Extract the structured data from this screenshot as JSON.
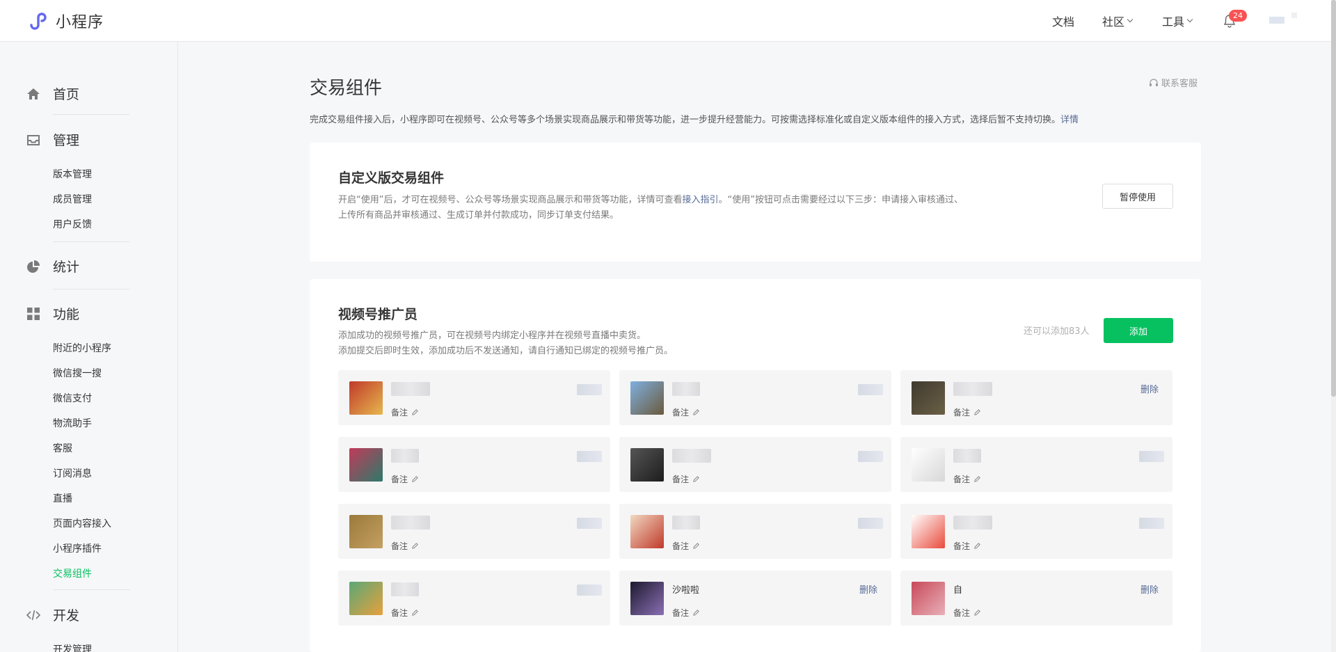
{
  "header": {
    "app_name": "小程序",
    "nav": [
      {
        "label": "文档",
        "dropdown": false
      },
      {
        "label": "社区",
        "dropdown": true
      },
      {
        "label": "工具",
        "dropdown": true
      }
    ],
    "notification_count": "24"
  },
  "sidebar": {
    "sections": [
      {
        "label": "首页",
        "icon": "home-icon"
      },
      {
        "label": "管理",
        "icon": "inbox-icon"
      },
      {
        "label": "统计",
        "icon": "pie-chart-icon"
      },
      {
        "label": "功能",
        "icon": "grid-icon"
      },
      {
        "label": "开发",
        "icon": "code-icon"
      }
    ],
    "manage_items": [
      "版本管理",
      "成员管理",
      "用户反馈"
    ],
    "feature_items": [
      "附近的小程序",
      "微信搜一搜",
      "微信支付",
      "物流助手",
      "客服",
      "订阅消息",
      "直播",
      "页面内容接入",
      "小程序插件",
      "交易组件"
    ],
    "dev_items": [
      "开发管理"
    ],
    "active_item": "交易组件"
  },
  "main": {
    "title": "交易组件",
    "service_link": "联系客服",
    "intro": "完成交易组件接入后，小程序即可在视频号、公众号等多个场景实现商品展示和带货等功能，进一步提升经营能力。可按需选择标准化或自定义版本组件的接入方式，选择后暂不支持切换。",
    "intro_link": "详情",
    "custom_card": {
      "title": "自定义版交易组件",
      "desc_prefix": "开启“使用”后，才可在视频号、公众号等场景实现商品展示和带货等功能，详情可查看",
      "desc_link": "接入指引",
      "desc_suffix": "。“使用”按钮可点击需要经过以下三步：申请接入审核通过、",
      "desc_line2": "上传所有商品并审核通过、生成订单并付款成功，同步订单支付结果。",
      "button": "暂停使用"
    },
    "promoter_card": {
      "title": "视频号推广员",
      "desc_line1": "添加成功的视频号推广员，可在视频号内绑定小程序并在视频号直播中卖货。",
      "desc_line2": "添加提交后即时生效，添加成功后不发送通知，请自行通知已绑定的视频号推广员。",
      "remain": "还可以添加83人",
      "add_button": "添加",
      "note_label": "备注",
      "delete_label": "删除",
      "promoters": [
        {
          "name": "",
          "show_delete": false,
          "avatar": [
            "#c0392b",
            "#e6b84d"
          ]
        },
        {
          "name": "",
          "show_delete": false,
          "avatar": [
            "#7fb0e0",
            "#6b5a3c"
          ]
        },
        {
          "name": "",
          "show_delete": true,
          "avatar": [
            "#3f3a2f",
            "#6b6046"
          ]
        },
        {
          "name": "",
          "show_delete": false,
          "avatar": [
            "#c23a5a",
            "#2c7a6a"
          ]
        },
        {
          "name": "",
          "show_delete": false,
          "avatar": [
            "#555555",
            "#1d1d1d"
          ]
        },
        {
          "name": "",
          "show_delete": false,
          "avatar": [
            "#ffffff",
            "#d8d8d8"
          ]
        },
        {
          "name": "",
          "show_delete": false,
          "avatar": [
            "#9a7a3a",
            "#c4a063"
          ]
        },
        {
          "name": "",
          "show_delete": false,
          "avatar": [
            "#f1d9c1",
            "#c0392b"
          ]
        },
        {
          "name": "",
          "show_delete": false,
          "avatar": [
            "#ffffff",
            "#e94b3c"
          ]
        },
        {
          "name": "",
          "show_delete": false,
          "avatar": [
            "#5aa877",
            "#e8a03c"
          ]
        },
        {
          "name": "沙啦啦",
          "show_delete": true,
          "avatar": [
            "#1e1a2e",
            "#8a6fb5"
          ]
        },
        {
          "name": "自",
          "show_delete": true,
          "avatar": [
            "#c84a5a",
            "#e8b0b8"
          ]
        }
      ]
    }
  },
  "colors": {
    "accent": "#07c160",
    "link": "#576b95",
    "badge": "#fa5151"
  }
}
